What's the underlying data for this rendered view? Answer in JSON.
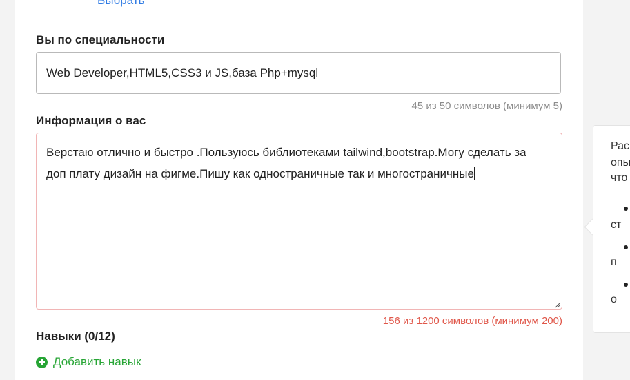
{
  "form": {
    "choose_link": "Выбрать",
    "specialty": {
      "label": "Вы по специальности",
      "value": "Web Developer,HTML5,CSS3 и  JS,база Php+mysql",
      "counter": "45 из 50 символов (минимум 5)"
    },
    "about": {
      "label": "Информация о вас",
      "value": "Верстаю отлично и быстро .Пользуюсь библиотеками tailwind,bootstrap.Могу сделать за доп плату дизайн на фигме.Пишу  как одностраничные так и многостраничные",
      "counter": "156 из 1200 символов (минимум 200)"
    },
    "skills": {
      "label": "Навыки (0/12)",
      "add_label": "Добавить навык"
    }
  },
  "side_panel": {
    "lines": [
      "Рас",
      "опы",
      "что"
    ],
    "bullets": [
      "ст",
      "п",
      "о"
    ]
  },
  "colors": {
    "link": "#2f7be4",
    "error": "#e0574a",
    "success": "#27a535",
    "muted": "#8c8c8c"
  }
}
